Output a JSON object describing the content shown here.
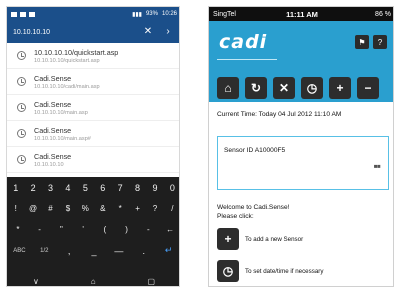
{
  "androidScreen": {
    "status": {
      "indicator": "93%",
      "time": "10:26"
    },
    "url_bar": {
      "url": "10.10.10.10",
      "close": "✕",
      "go": "›"
    },
    "history": [
      {
        "title": "10.10.10.10/quickstart.asp",
        "url": "10.10.10.10/quickstart.asp"
      },
      {
        "title": "Cadi.Sense",
        "url": "10.10.10.10/cadi/main.asp"
      },
      {
        "title": "Cadi.Sense",
        "url": "10.10.10.10/main.asp"
      },
      {
        "title": "Cadi.Sense",
        "url": "10.10.10.10/main.asp#"
      },
      {
        "title": "Cadi.Sense",
        "url": "10.10.10.10"
      }
    ],
    "keyboard": {
      "row1": [
        "1",
        "2",
        "3",
        "4",
        "5",
        "6",
        "7",
        "8",
        "9",
        "0"
      ],
      "row2": [
        "!",
        "@",
        "#",
        "$",
        "%",
        "&",
        "*",
        "+",
        "?",
        "/"
      ],
      "row3": [
        "*",
        "-",
        "\"",
        "'",
        "(",
        ")",
        "-",
        "←"
      ],
      "row4": [
        "ABC",
        "1/2",
        ",",
        "_",
        "—",
        ".",
        "↵"
      ],
      "nav": [
        "∨",
        "⌂",
        "▢"
      ]
    }
  },
  "iosScreen": {
    "status": {
      "carrier": "SingTel",
      "time": "11:11 AM",
      "battery": "86 %"
    },
    "logo": "cadi",
    "header_buttons": [
      "⚑",
      "?"
    ],
    "toolbar": [
      "⌂",
      "↻",
      "✕",
      "◷",
      "+",
      "−"
    ],
    "current_time": "Current Time: Today 04 Jul 2012 11:10 AM",
    "sensor_card": {
      "label": "Sensor ID A10000F5",
      "indicator": "▪▪"
    },
    "welcome": {
      "line1": "Welcome to Cadi.Sense!",
      "line2": "Please click:"
    },
    "actions": [
      {
        "icon": "+",
        "label": "To add a new Sensor"
      },
      {
        "icon": "◷",
        "label": "To set date/time if necessary"
      }
    ],
    "colors": {
      "header": "#2a9fcf",
      "button": "#2d2d2d",
      "card_border": "#58c0e6"
    }
  }
}
